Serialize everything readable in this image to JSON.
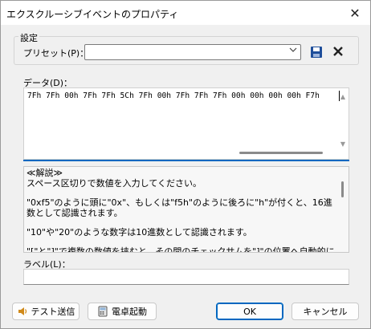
{
  "window": {
    "title": "エクスクルーシブイベントのプロパティ"
  },
  "settings": {
    "group_label": "設定",
    "preset_label": "プリセット(P)：",
    "preset_value": ""
  },
  "data": {
    "label": "データ(D)：",
    "value": "7Fh 7Fh 00h 7Fh 7Fh 5Ch 7Fh 00h 7Fh 7Fh 7Fh 00h 00h 00h 00h F7h"
  },
  "help": {
    "heading": "≪解説≫",
    "paragraphs": [
      "スペース区切りで数値を入力してください。",
      "\"0xf5\"のように頭に\"0x\"、もしくは\"f5h\"のように後ろに\"h\"が付くと、16進数として認識されます。",
      "\"10\"や\"20\"のような数字は10進数として認識されます。",
      "\"[\"と\"]\"で複数の数値を挟むと、その間のチェックサムを\"]\"の位置へ自動的に挿"
    ]
  },
  "label_field": {
    "label": "ラベル(L)：",
    "value": ""
  },
  "buttons": {
    "test_send": "テスト送信",
    "calculator": "電卓起動",
    "ok": "OK",
    "cancel": "キャンセル"
  },
  "icons": {
    "close": "close-icon",
    "save": "save-icon",
    "delete": "delete-icon",
    "speaker": "speaker-icon",
    "calculator": "calculator-icon"
  },
  "colors": {
    "accent": "#0067c0",
    "save_icon": "#1e4e9a"
  }
}
